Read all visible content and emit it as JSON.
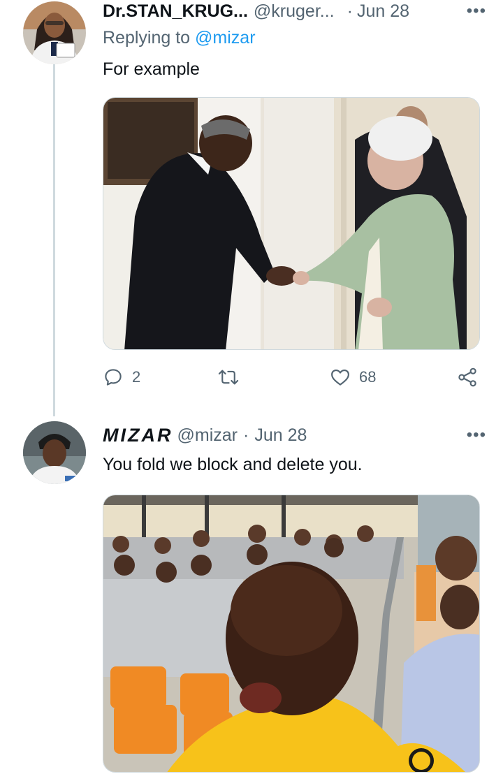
{
  "tweets": [
    {
      "display_name": "Dr.STAN_KRUG...",
      "handle": "@kruger...",
      "separator": "·",
      "date": "Jun 28",
      "more": "•••",
      "replying_prefix": "Replying to",
      "replying_to": "@mizar",
      "text": "For example",
      "actions": {
        "reply_count": "2",
        "retweet_count": "",
        "like_count": "68"
      }
    },
    {
      "display_name": "MIZAR",
      "handle": "@mizar",
      "separator": "·",
      "date": "Jun 28",
      "more": "•••",
      "text": "You fold we block and delete you."
    }
  ],
  "colors": {
    "text_primary": "#0f1419",
    "text_secondary": "#536471",
    "link": "#1d9bf0",
    "thread_line": "#cfd9de"
  },
  "icons": [
    "reply-icon",
    "retweet-icon",
    "like-icon",
    "share-icon",
    "more-icon"
  ]
}
